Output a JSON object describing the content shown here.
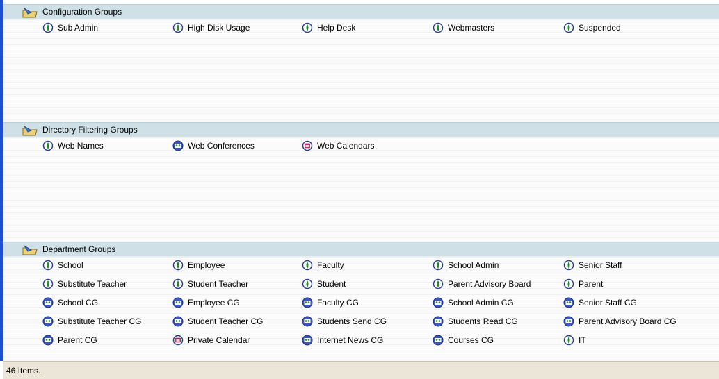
{
  "groups": [
    {
      "title": "Configuration Groups",
      "items": [
        {
          "label": "Sub Admin",
          "icon": "person-group-icon"
        },
        {
          "label": "High Disk Usage",
          "icon": "person-group-icon"
        },
        {
          "label": "Help Desk",
          "icon": "person-group-icon"
        },
        {
          "label": "Webmasters",
          "icon": "person-group-icon"
        },
        {
          "label": "Suspended",
          "icon": "person-group-icon"
        }
      ]
    },
    {
      "title": "Directory Filtering  Groups",
      "items": [
        {
          "label": "Web Names",
          "icon": "person-group-icon"
        },
        {
          "label": "Web Conferences",
          "icon": "conference-group-icon"
        },
        {
          "label": "Web Calendars",
          "icon": "calendar-group-icon"
        }
      ]
    },
    {
      "title": "Department Groups",
      "items": [
        {
          "label": "School",
          "icon": "person-group-icon"
        },
        {
          "label": "Employee",
          "icon": "person-group-icon"
        },
        {
          "label": "Faculty",
          "icon": "person-group-icon"
        },
        {
          "label": "School Admin",
          "icon": "person-group-icon"
        },
        {
          "label": "Senior Staff",
          "icon": "person-group-icon"
        },
        {
          "label": "Substitute Teacher",
          "icon": "person-group-icon"
        },
        {
          "label": "Student Teacher",
          "icon": "person-group-icon"
        },
        {
          "label": "Student",
          "icon": "person-group-icon"
        },
        {
          "label": "Parent Advisory Board",
          "icon": "person-group-icon"
        },
        {
          "label": "Parent",
          "icon": "person-group-icon"
        },
        {
          "label": "School CG",
          "icon": "conference-group-icon"
        },
        {
          "label": "Employee CG",
          "icon": "conference-group-icon"
        },
        {
          "label": "Faculty CG",
          "icon": "conference-group-icon"
        },
        {
          "label": "School Admin CG",
          "icon": "conference-group-icon"
        },
        {
          "label": "Senior Staff CG",
          "icon": "conference-group-icon"
        },
        {
          "label": "Substitute Teacher CG",
          "icon": "conference-group-icon"
        },
        {
          "label": "Student Teacher CG",
          "icon": "conference-group-icon"
        },
        {
          "label": "Students Send CG",
          "icon": "conference-group-icon"
        },
        {
          "label": "Students Read CG",
          "icon": "conference-group-icon"
        },
        {
          "label": "Parent Advisory Board CG",
          "icon": "conference-group-icon"
        },
        {
          "label": "Parent CG",
          "icon": "conference-group-icon"
        },
        {
          "label": "Private Calendar",
          "icon": "calendar-group-icon"
        },
        {
          "label": "Internet News CG",
          "icon": "conference-group-icon"
        },
        {
          "label": "Courses CG",
          "icon": "conference-group-icon"
        },
        {
          "label": "IT",
          "icon": "person-group-icon"
        }
      ]
    }
  ],
  "status": {
    "text": "46 Items."
  },
  "colors": {
    "accent_bar": "#1f4fd1",
    "header_bg": "#cfe0e6",
    "status_bg": "#ece6d8"
  }
}
